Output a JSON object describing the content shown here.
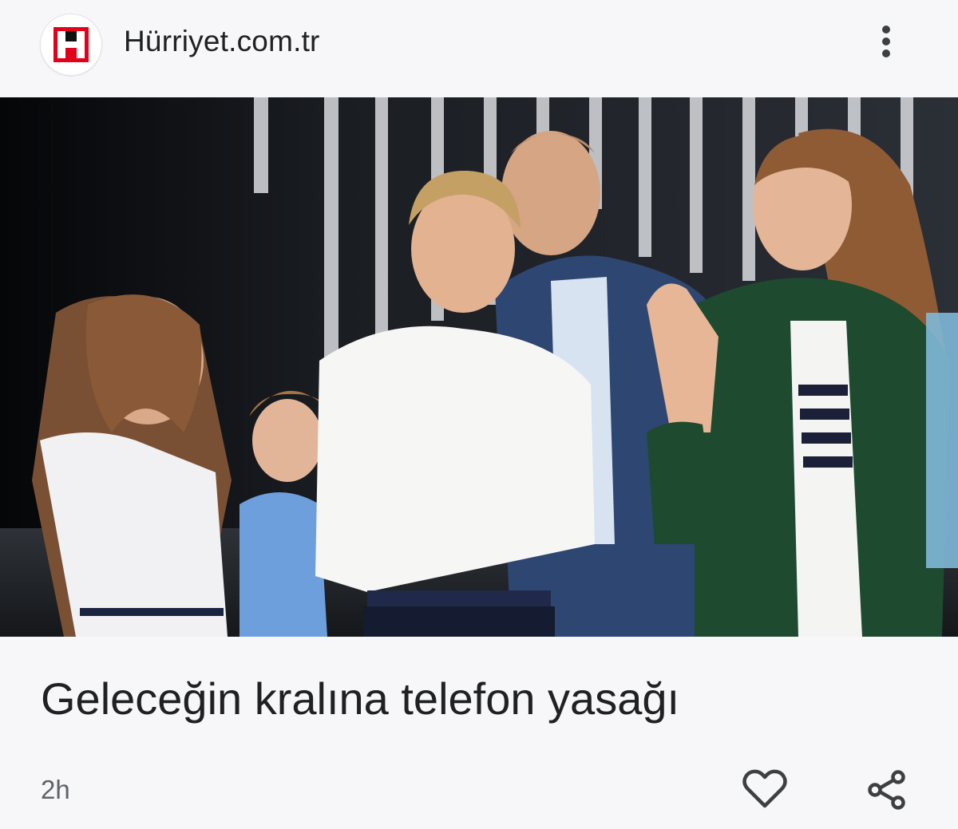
{
  "header": {
    "source_name": "Hürriyet.com.tr",
    "logo_icon": "hurriyet-logo-icon",
    "menu_icon": "more-vert-icon"
  },
  "article": {
    "headline": "Geleceğin kralına telefon yasağı",
    "time_ago": "2h",
    "like_icon": "heart-outline-icon",
    "share_icon": "share-icon"
  },
  "colors": {
    "background": "#f7f7fa",
    "logo_red": "#e3001b",
    "text": "#202124",
    "secondary_text": "#5f6368"
  }
}
